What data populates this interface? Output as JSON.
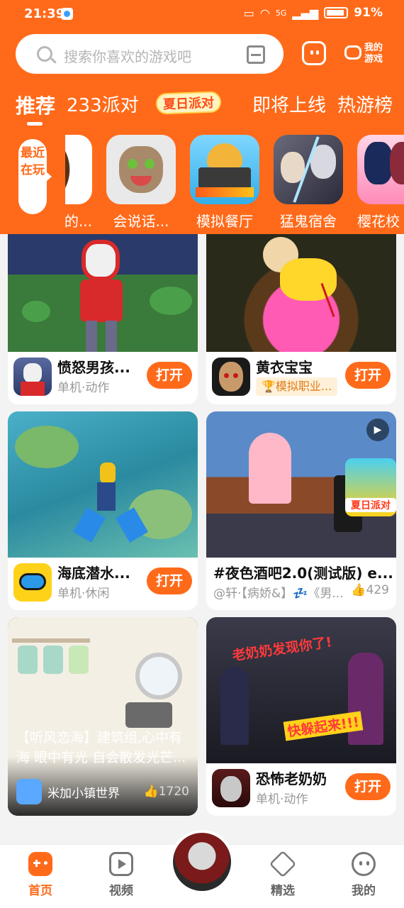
{
  "status_bar": {
    "time": "21:39",
    "signal": "5G",
    "battery": "91%"
  },
  "search": {
    "placeholder": "搜索你喜欢的游戏吧"
  },
  "header": {
    "my_games_label": "我的游戏"
  },
  "tabs": [
    {
      "label": "推荐",
      "active": true
    },
    {
      "label": "233派对"
    },
    {
      "label": "夏日派对"
    },
    {
      "label": "即将上线"
    },
    {
      "label": "热游榜"
    }
  ],
  "recent": {
    "tag": "最近在玩",
    "items": [
      {
        "label": "的..."
      },
      {
        "label": "会说话..."
      },
      {
        "label": "模拟餐厅"
      },
      {
        "label": "猛鬼宿舍"
      },
      {
        "label": "樱花校"
      }
    ]
  },
  "cards": [
    {
      "title": "愤怒男孩...",
      "sub": "单机·动作",
      "button": "打开"
    },
    {
      "title": "黄衣宝宝",
      "badge": "模拟职业...",
      "button": "打开"
    },
    {
      "title": "海底潜水...",
      "sub": "单机·休闲",
      "button": "打开"
    },
    {
      "title": "#夜色酒吧2.0(测试版) e...",
      "sub": "@轩·【病娇&】💤《男...",
      "likes": "429",
      "overlay_label": "夏日派对"
    },
    {
      "caption": "【听风恋海】建筑组,心中有海 眼中有光 自会散发光芒...",
      "author": "米加小镇世界",
      "likes": "1720"
    },
    {
      "title": "恐怖老奶奶",
      "sub": "单机·动作",
      "button": "打开",
      "image_text_1": "老奶奶发现你了!",
      "image_text_2": "快躲起来!!!"
    }
  ],
  "bottom_nav": [
    {
      "label": "首页",
      "active": true
    },
    {
      "label": "视频"
    },
    {
      "label": "精选"
    },
    {
      "label": "我的"
    }
  ],
  "colors": {
    "brand": "#ff6a1a",
    "background": "#f3f3f3"
  }
}
